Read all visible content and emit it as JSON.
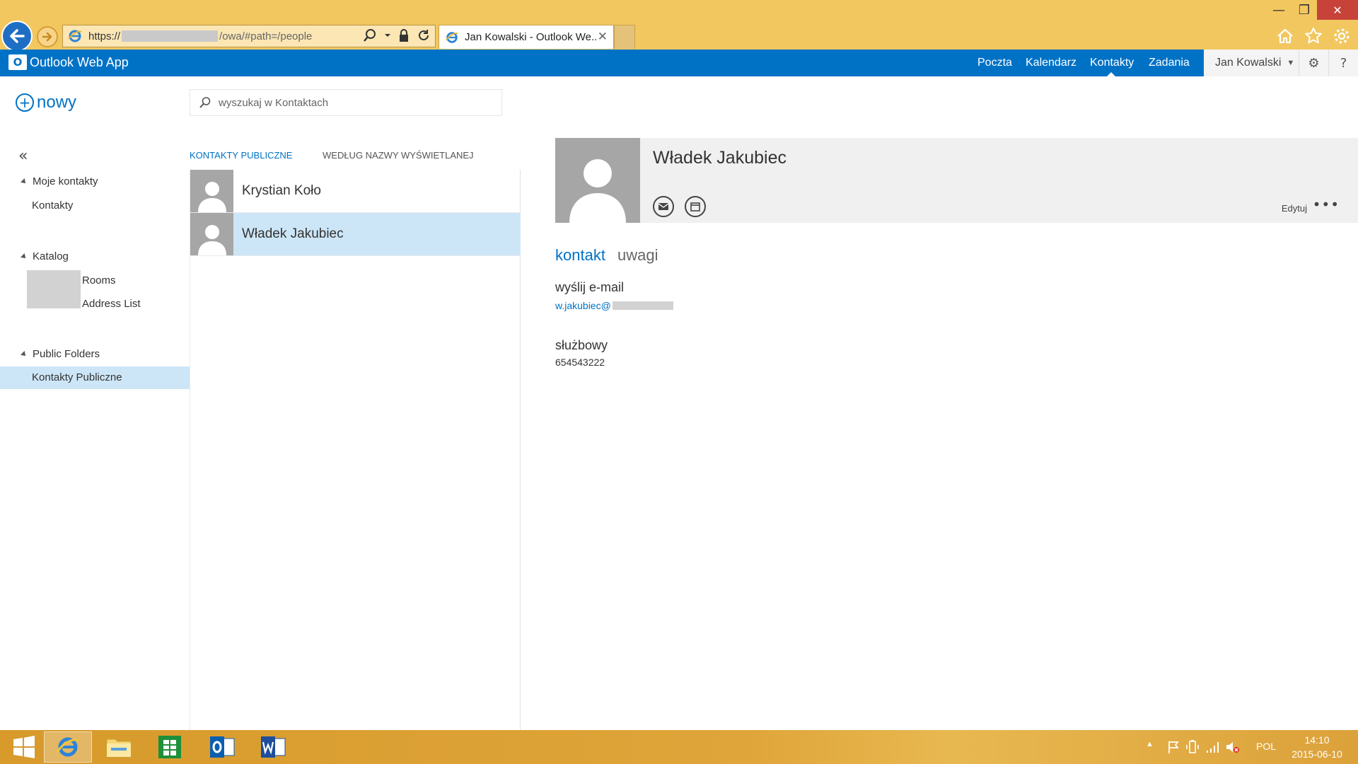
{
  "window": {
    "min_glyph": "—",
    "max_glyph": "❐",
    "close_glyph": "✕"
  },
  "browser": {
    "url_prefix": "https://",
    "url_path": "/owa/#path=/people",
    "tab_title": "Jan Kowalski - Outlook We...",
    "tab_close": "✕"
  },
  "app": {
    "name": "Outlook Web App",
    "logo_letter": "O",
    "accent": "#0072c6",
    "selection": "#cde6f7"
  },
  "nav": {
    "items": [
      {
        "label": "Poczta"
      },
      {
        "label": "Kalendarz"
      },
      {
        "label": "Kontakty",
        "active": true
      },
      {
        "label": "Zadania"
      }
    ],
    "user": "Jan Kowalski",
    "settings_icon": "⚙",
    "help_icon": "?"
  },
  "toolbar": {
    "new_label": "nowy",
    "search_placeholder": "wyszukaj w Kontaktach"
  },
  "folders": {
    "collapse_glyph": "«",
    "groups": [
      {
        "label": "Moje kontakty",
        "items": [
          "Kontakty"
        ]
      },
      {
        "label": "Katalog",
        "items": [
          "Rooms",
          "Address List"
        ]
      },
      {
        "label": "Public Folders",
        "items": [
          "Kontakty Publiczne"
        ]
      }
    ],
    "selected": "Kontakty Publiczne"
  },
  "list": {
    "header_folder": "KONTAKTY PUBLICZNE",
    "header_sort": "WEDŁUG NAZWY WYŚWIETLANEJ",
    "contacts": [
      {
        "name": "Krystian Koło",
        "selected": false
      },
      {
        "name": "Władek Jakubiec",
        "selected": true
      }
    ]
  },
  "detail": {
    "name": "Władek Jakubiec",
    "edit_label": "Edytuj",
    "more_label": "•••",
    "tabs": [
      "kontakt",
      "uwagi"
    ],
    "email_label": "wyślij e-mail",
    "email_value": "w.jakubiec@",
    "work_label": "służbowy",
    "work_value": "654543222"
  },
  "taskbar": {
    "lang": "POL",
    "time": "14:10",
    "date": "2015-06-10"
  }
}
